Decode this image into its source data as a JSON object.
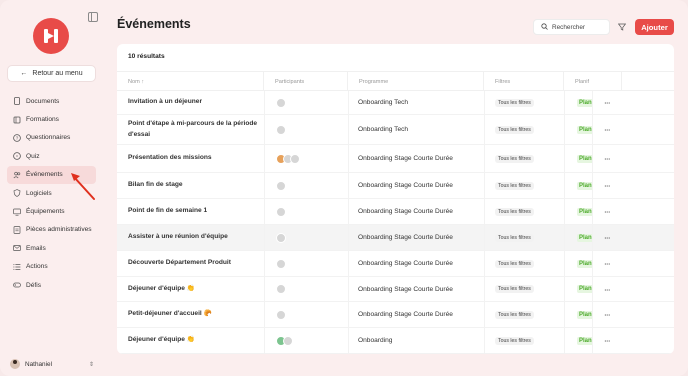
{
  "sidebar": {
    "back_label": "Retour au menu",
    "items": [
      {
        "label": "Documents",
        "icon": "document-icon"
      },
      {
        "label": "Formations",
        "icon": "book-icon"
      },
      {
        "label": "Questionnaires",
        "icon": "question-icon"
      },
      {
        "label": "Quiz",
        "icon": "chat-icon"
      },
      {
        "label": "Événements",
        "icon": "users-icon",
        "active": true
      },
      {
        "label": "Logiciels",
        "icon": "shield-icon"
      },
      {
        "label": "Équipements",
        "icon": "monitor-icon"
      },
      {
        "label": "Pièces administratives",
        "icon": "file-icon"
      },
      {
        "label": "Emails",
        "icon": "mail-icon"
      },
      {
        "label": "Actions",
        "icon": "list-icon"
      },
      {
        "label": "Défis",
        "icon": "gamepad-icon"
      }
    ],
    "user_name": "Nathaniel"
  },
  "header": {
    "title": "Événements",
    "search_placeholder": "Rechercher",
    "add_label": "Ajouter"
  },
  "table": {
    "results": "10 résultats",
    "columns": [
      "Nom ↑",
      "Participants",
      "Programme",
      "Filtres",
      "Planif"
    ],
    "rows": [
      {
        "name": "Invitation à un déjeuner",
        "program": "Onboarding Tech",
        "filter": "Tous les filtres",
        "plan": "Planifié",
        "avatars": [
          "grey"
        ]
      },
      {
        "name": "Point d'étape à mi-parcours de la période d'essai",
        "program": "Onboarding Tech",
        "filter": "Tous les filtres",
        "plan": "Planifié",
        "avatars": [
          "grey"
        ]
      },
      {
        "name": "Présentation des missions",
        "program": "Onboarding Stage Courte Durée",
        "filter": "Tous les filtres",
        "plan": "Planifié",
        "avatars": [
          "orange",
          "grey",
          "grey"
        ]
      },
      {
        "name": "Bilan fin de stage",
        "program": "Onboarding Stage Courte Durée",
        "filter": "Tous les filtres",
        "plan": "Planifié",
        "avatars": [
          "grey"
        ]
      },
      {
        "name": "Point de fin de semaine 1",
        "program": "Onboarding Stage Courte Durée",
        "filter": "Tous les filtres",
        "plan": "Planifié",
        "avatars": [
          "grey"
        ]
      },
      {
        "name": "Assister à une réunion d'équipe",
        "program": "Onboarding Stage Courte Durée",
        "filter": "Tous les filtres",
        "plan": "Planifié",
        "avatars": [
          "grey"
        ]
      },
      {
        "name": "Découverte Département Produit",
        "program": "Onboarding Stage Courte Durée",
        "filter": "Tous les filtres",
        "plan": "Planifié",
        "avatars": [
          "grey"
        ]
      },
      {
        "name": "Déjeuner d'équipe 👏",
        "program": "Onboarding Stage Courte Durée",
        "filter": "Tous les filtres",
        "plan": "Planifié",
        "avatars": [
          "grey"
        ]
      },
      {
        "name": "Petit-déjeuner d'accueil 🥐",
        "program": "Onboarding Stage Courte Durée",
        "filter": "Tous les filtres",
        "plan": "Planifié",
        "avatars": [
          "grey"
        ]
      },
      {
        "name": "Déjeuner d'équipe 👏",
        "program": "Onboarding",
        "filter": "Tous les filtres",
        "plan": "Planifié",
        "avatars": [
          "green",
          "grey"
        ]
      }
    ]
  },
  "colors": {
    "accent": "#e84b48",
    "active_bg": "#f7dada",
    "plan_green": "#4caa2a"
  }
}
